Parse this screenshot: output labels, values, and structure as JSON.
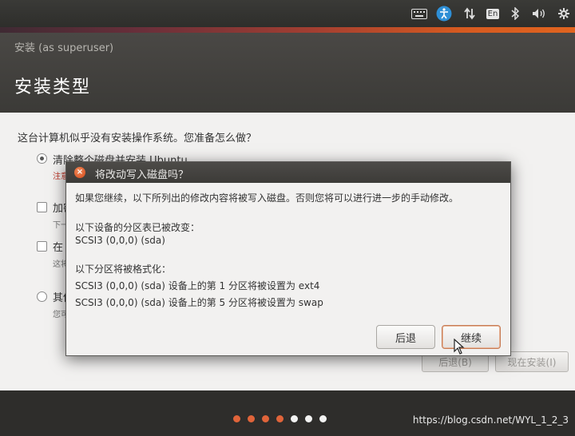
{
  "top_panel": {
    "keyboard_lang": "En"
  },
  "window": {
    "title_small": "安装 (as superuser)",
    "title_big": "安装类型"
  },
  "main": {
    "question": "这台计算机似乎没有安装操作系统。您准备怎么做？",
    "options": [
      {
        "label": "清除整个磁盘并安装 Ubuntu",
        "sub": "注意",
        "selected": true,
        "type": "radio"
      },
      {
        "label": "加密",
        "sub": "下一",
        "selected": false,
        "type": "checkbox"
      },
      {
        "label": "在",
        "sub": "这将",
        "selected": false,
        "type": "checkbox"
      },
      {
        "label": "其他",
        "sub": "您可",
        "selected": false,
        "type": "radio"
      }
    ],
    "back_button": "后退(B)",
    "install_button": "现在安装(I)"
  },
  "dialog": {
    "title": "将改动写入磁盘吗？",
    "intro": "如果您继续，以下所列出的修改内容将被写入磁盘。否则您将可以进行进一步的手动修改。",
    "partition_heading": "以下设备的分区表已被改变：",
    "partition_device": "SCSI3 (0,0,0) (sda)",
    "format_heading": "以下分区将被格式化：",
    "format_line_1": "SCSI3 (0,0,0) (sda) 设备上的第 1 分区将被设置为 ext4",
    "format_line_2": "SCSI3 (0,0,0) (sda) 设备上的第 5 分区将被设置为 swap",
    "back_label": "后退",
    "continue_label": "继续"
  },
  "progress": {
    "total_steps": 7,
    "completed_steps": 4,
    "done_color": "#e0643a",
    "todo_color": "#f2f2f2"
  },
  "watermark": "https://blog.csdn.net/WYL_1_2_3",
  "colors": {
    "accent": "#e0641f",
    "panel": "#3a3a37"
  }
}
